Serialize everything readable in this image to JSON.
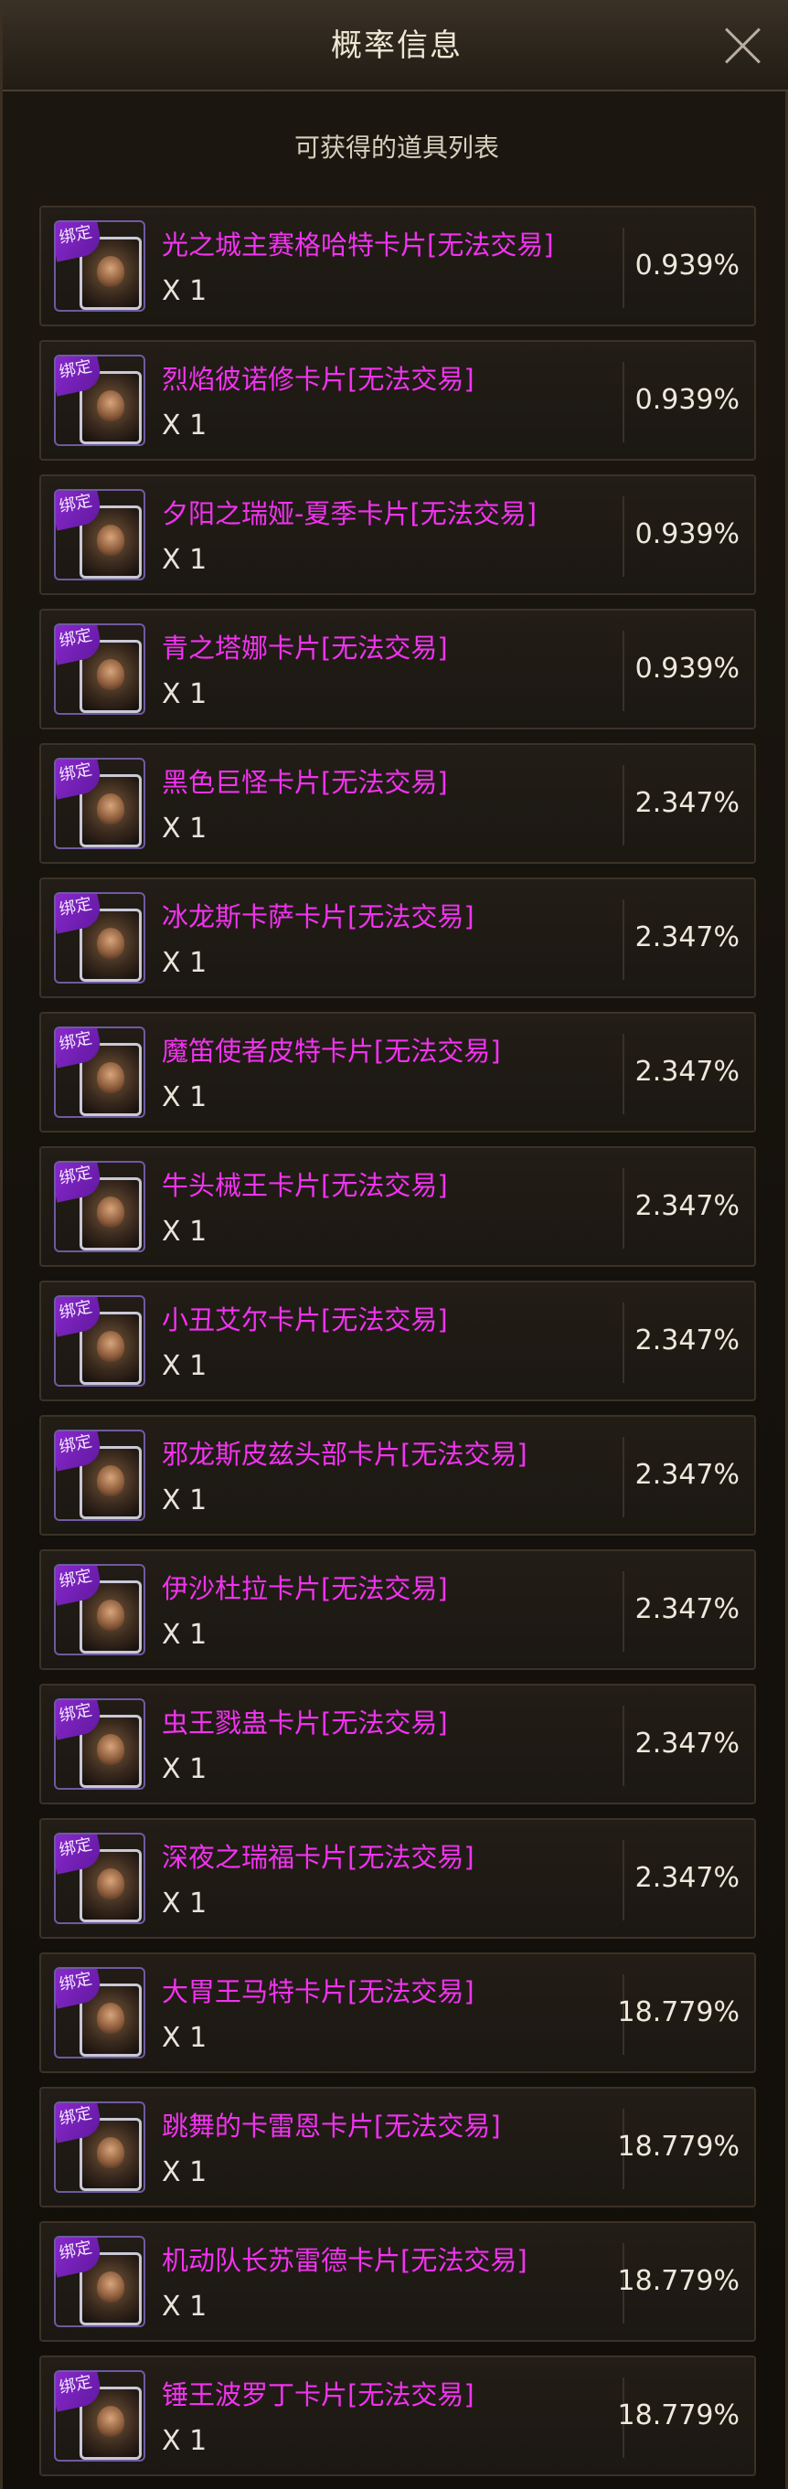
{
  "header": {
    "title": "概率信息"
  },
  "section": {
    "title": "可获得的道具列表"
  },
  "badge_label": "绑定",
  "items": [
    {
      "name": "光之城主赛格哈特卡片[无法交易]",
      "qty": "X 1",
      "prob": "0.939%",
      "icon": "card-icon"
    },
    {
      "name": "烈焰彼诺修卡片[无法交易]",
      "qty": "X 1",
      "prob": "0.939%",
      "icon": "card-icon"
    },
    {
      "name": "夕阳之瑞娅-夏季卡片[无法交易]",
      "qty": "X 1",
      "prob": "0.939%",
      "icon": "card-icon"
    },
    {
      "name": "青之塔娜卡片[无法交易]",
      "qty": "X 1",
      "prob": "0.939%",
      "icon": "card-icon"
    },
    {
      "name": "黑色巨怪卡片[无法交易]",
      "qty": "X 1",
      "prob": "2.347%",
      "icon": "card-icon"
    },
    {
      "name": "冰龙斯卡萨卡片[无法交易]",
      "qty": "X 1",
      "prob": "2.347%",
      "icon": "card-icon"
    },
    {
      "name": "魔笛使者皮特卡片[无法交易]",
      "qty": "X 1",
      "prob": "2.347%",
      "icon": "card-icon"
    },
    {
      "name": "牛头械王卡片[无法交易]",
      "qty": "X 1",
      "prob": "2.347%",
      "icon": "card-icon"
    },
    {
      "name": "小丑艾尔卡片[无法交易]",
      "qty": "X 1",
      "prob": "2.347%",
      "icon": "card-icon"
    },
    {
      "name": "邪龙斯皮兹头部卡片[无法交易]",
      "qty": "X 1",
      "prob": "2.347%",
      "icon": "card-icon"
    },
    {
      "name": "伊沙杜拉卡片[无法交易]",
      "qty": "X 1",
      "prob": "2.347%",
      "icon": "card-icon"
    },
    {
      "name": "虫王戮蛊卡片[无法交易]",
      "qty": "X 1",
      "prob": "2.347%",
      "icon": "card-icon"
    },
    {
      "name": "深夜之瑞福卡片[无法交易]",
      "qty": "X 1",
      "prob": "2.347%",
      "icon": "card-icon"
    },
    {
      "name": "大胃王马特卡片[无法交易]",
      "qty": "X 1",
      "prob": "18.779%",
      "icon": "card-icon"
    },
    {
      "name": "跳舞的卡雷恩卡片[无法交易]",
      "qty": "X 1",
      "prob": "18.779%",
      "icon": "card-icon"
    },
    {
      "name": "机动队长苏雷德卡片[无法交易]",
      "qty": "X 1",
      "prob": "18.779%",
      "icon": "card-icon"
    },
    {
      "name": "锤王波罗丁卡片[无法交易]",
      "qty": "X 1",
      "prob": "18.779%",
      "icon": "card-icon"
    }
  ]
}
